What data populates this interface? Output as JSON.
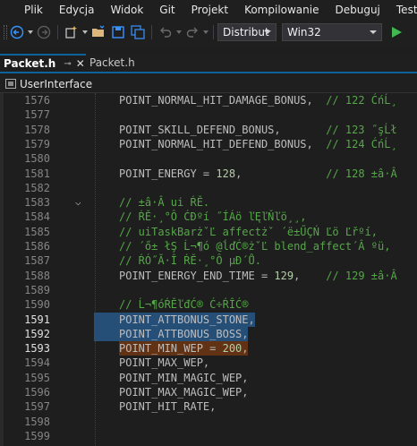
{
  "menu": {
    "items": [
      "Plik",
      "Edycja",
      "Widok",
      "Git",
      "Projekt",
      "Kompilowanie",
      "Debuguj",
      "Test"
    ]
  },
  "toolbar": {
    "configuration": "Distribut",
    "platform": "Win32"
  },
  "tabs": {
    "active": "Packet.h",
    "active_pin": "⊸",
    "active_close": "✕",
    "inactive": "Packet.h"
  },
  "navbar": {
    "scope": "UserInterface"
  },
  "colors": {
    "selection": "#264f78",
    "highlight": "#613214",
    "comment": "#57a64a",
    "number": "#b5cea8",
    "identifier": "#bdbdbd"
  },
  "editor": {
    "lines": [
      {
        "num": "1576",
        "code": "POINT_NORMAL_HIT_DAMAGE_BONUS,  // 122 ĆńĹ¸"
      },
      {
        "num": "1577",
        "code": ""
      },
      {
        "num": "1578",
        "code": "POINT_SKILL_DEFEND_BONUS,       // 123 ˝şĹł"
      },
      {
        "num": "1579",
        "code": "POINT_NORMAL_HIT_DEFEND_BONUS,  // 124 ĆńĹ¸"
      },
      {
        "num": "1580",
        "code": ""
      },
      {
        "num": "1581",
        "code": "POINT_ENERGY = 128,             // 128 ±â·Â"
      },
      {
        "num": "1582",
        "code": ""
      },
      {
        "num": "1583",
        "code": "// ±â·Â ui ŔĚ."
      },
      {
        "num": "1584",
        "code": "// ŔĚ·¸°Ô ĆĐºí ˝ÍÁö ľĘľŇľö¸¸,"
      },
      {
        "num": "1585",
        "code": "// uiTaskBarżˇĽ­ affectżˇ ´ë±ŰÇŃ Ľö Ľřºí,"
      },
      {
        "num": "1586",
        "code": "// ´ő± łŞ Ĺ¬¶ó @ĺďĆ®żˇĽ­ blend_affect´Â ºü,"
      },
      {
        "num": "1587",
        "code": "// ŔÓ˝Ă·Î ŔĚ·¸°Ô µĐ´Ů."
      },
      {
        "num": "1588",
        "code": "POINT_ENERGY_END_TIME = 129,    // 129 ±â·Â"
      },
      {
        "num": "1589",
        "code": ""
      },
      {
        "num": "1590",
        "code": "// Ĺ¬¶óŔĚľđĆ® Ć÷ŔÎĆ®"
      },
      {
        "num": "1591",
        "code": "POINT_ATTBONUS_STONE,"
      },
      {
        "num": "1592",
        "code": "POINT_ATTBONUS_BOSS,"
      },
      {
        "num": "1593",
        "code": "POINT_MIN_WEP = 200,"
      },
      {
        "num": "1594",
        "code": "POINT_MAX_WEP,"
      },
      {
        "num": "1595",
        "code": "POINT_MIN_MAGIC_WEP,"
      },
      {
        "num": "1596",
        "code": "POINT_MAX_MAGIC_WEP,"
      },
      {
        "num": "1597",
        "code": "POINT_HIT_RATE,"
      },
      {
        "num": "1598",
        "code": ""
      },
      {
        "num": "1599",
        "code": ""
      }
    ]
  }
}
